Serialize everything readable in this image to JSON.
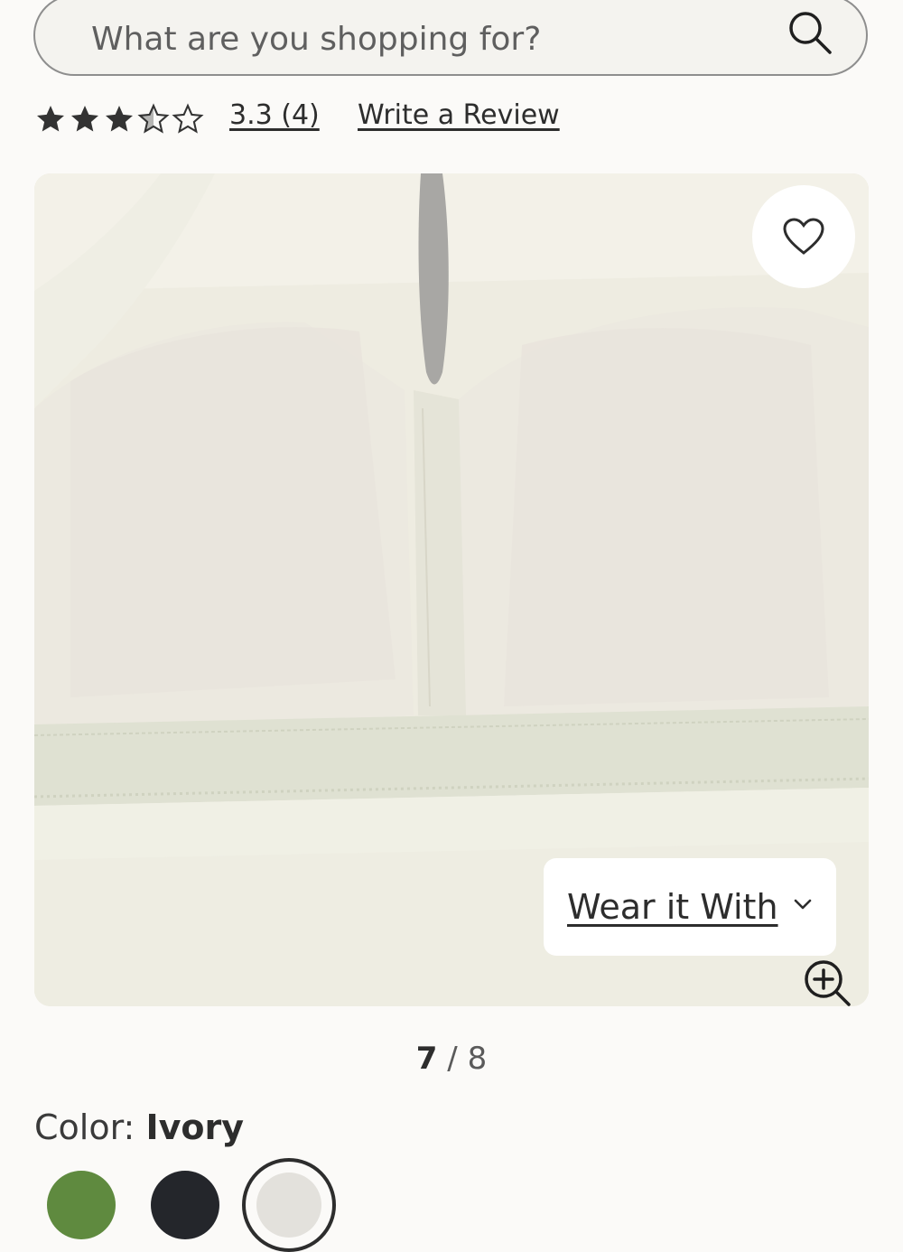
{
  "search": {
    "placeholder": "What are you shopping for?"
  },
  "rating": {
    "stars_filled": 3,
    "stars_total": 5,
    "summary": "3.3 (4)",
    "write_review": "Write a Review"
  },
  "gallery": {
    "wear_it_with": "Wear it With",
    "current": "7",
    "separator": "/",
    "total": "8"
  },
  "color": {
    "label": "Color:",
    "value": "Ivory"
  },
  "swatches": [
    {
      "name": "green",
      "hex": "#5f8a3f"
    },
    {
      "name": "black",
      "hex": "#24262b"
    },
    {
      "name": "ivory",
      "hex": "#e3e1dc",
      "selected": true
    }
  ],
  "icons": [
    "search-icon",
    "star-icon",
    "heart-icon",
    "chevron-down-icon",
    "zoom-in-icon"
  ]
}
